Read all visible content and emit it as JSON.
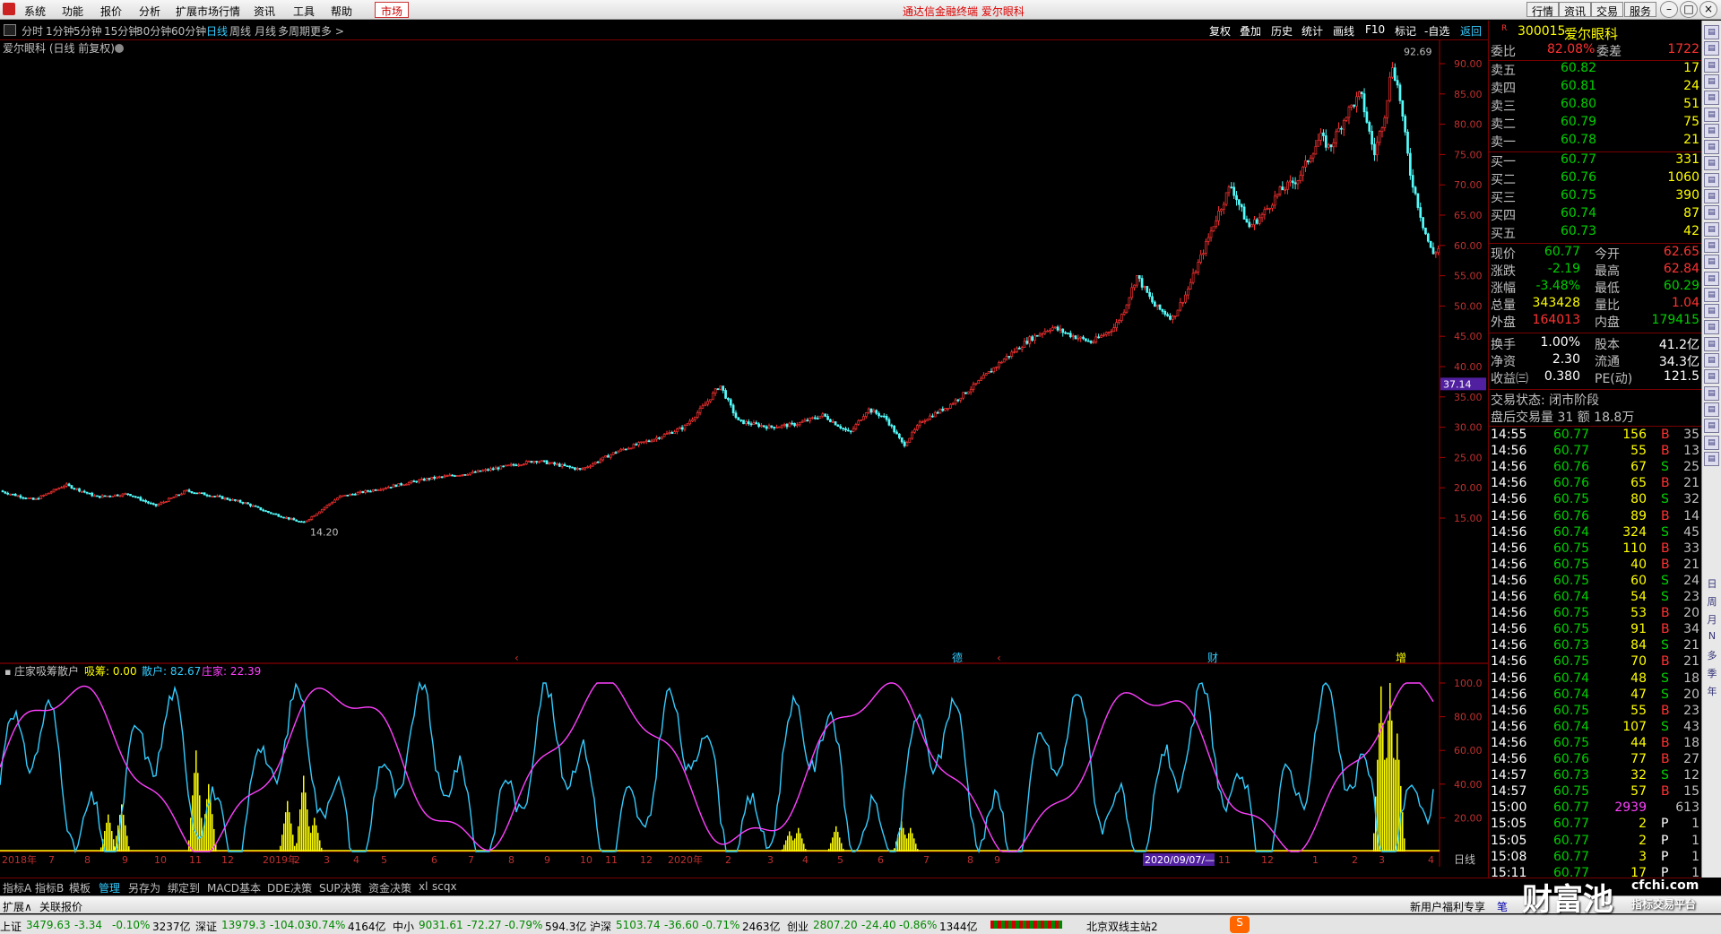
{
  "menu": {
    "items": [
      "系统",
      "功能",
      "报价",
      "分析",
      "扩展市场行情",
      "资讯",
      "工具",
      "帮助"
    ],
    "market": "市场",
    "title": "通达信金融终端  爱尔眼科",
    "right_buttons": [
      "行情",
      "资讯",
      "交易",
      "服务"
    ]
  },
  "periods": {
    "items": [
      "分时",
      "1分钟",
      "5分钟",
      "15分钟",
      "30分钟",
      "60分钟",
      "日线",
      "周线",
      "月线",
      "多周期",
      "更多 >"
    ],
    "active": "日线",
    "tools": [
      "复权",
      "叠加",
      "历史",
      "统计",
      "画线",
      "F10",
      "标记",
      "-自选"
    ],
    "back": "返回"
  },
  "chart": {
    "title": "爱尔眼科 (日线 前复权)",
    "high_label": "92.69",
    "low_label": "14.20",
    "current_price_tag": "37.14",
    "y_ticks": [
      "90.00",
      "85.00",
      "80.00",
      "75.00",
      "70.00",
      "65.00",
      "60.00",
      "55.00",
      "50.00",
      "45.00",
      "40.00",
      "35.00",
      "30.00",
      "25.00",
      "20.00",
      "15.00"
    ],
    "event_markers": [
      "‹",
      "德",
      "‹",
      "财",
      "增"
    ],
    "ind_name": "庄家吸筹散户",
    "ind_xichou": "吸筹: 0.00",
    "ind_sanhu": "散户: 82.67",
    "ind_zhuangjia": "庄家: 22.39",
    "ind_ticks": [
      "100.0",
      "80.00",
      "60.00",
      "40.00",
      "20.00"
    ],
    "x_labels": [
      "2018年",
      "7",
      "8",
      "9",
      "10",
      "11",
      "12",
      "2019年",
      "2",
      "3",
      "4",
      "5",
      "6",
      "7",
      "8",
      "9",
      "10",
      "11",
      "12",
      "2020年",
      "2",
      "3",
      "4",
      "5",
      "6",
      "7",
      "8",
      "9",
      "2020/09/07/—",
      "11",
      "12",
      "1",
      "2",
      "3",
      "4"
    ],
    "period_label": "日线",
    "colors": {
      "up": "#ff3232",
      "down": "#54fcfc",
      "sanhu": "#ff40ff",
      "zhuangjia": "#3cf",
      "xichou": "#ffff00"
    }
  },
  "chart_data": {
    "type": "candlestick",
    "x_range": [
      "2018-06",
      "2021-04"
    ],
    "y_range": [
      14.2,
      92.69
    ],
    "key_points": [
      {
        "x": "2018",
        "y": 19.5
      },
      {
        "x": "2018-10",
        "y": 17.5
      },
      {
        "x": "2019-01",
        "y": 14.2
      },
      {
        "x": "2019-06",
        "y": 24.5
      },
      {
        "x": "2019-10",
        "y": 36.0
      },
      {
        "x": "2020-03",
        "y": 27.0
      },
      {
        "x": "2020-06",
        "y": 47.5
      },
      {
        "x": "2020-09",
        "y": 70.5
      },
      {
        "x": "2021-01",
        "y": 92.69
      },
      {
        "x": "2021-03",
        "y": 54.5
      },
      {
        "x": "2021-04",
        "y": 60.77
      }
    ]
  },
  "quote": {
    "code": "300015",
    "name": "爱尔眼科",
    "weibi_label": "委比",
    "weibi": "82.08%",
    "weicha_label": "委差",
    "weicha": "1722",
    "asks": [
      {
        "label": "卖五",
        "price": "60.82",
        "vol": "17"
      },
      {
        "label": "卖四",
        "price": "60.81",
        "vol": "24"
      },
      {
        "label": "卖三",
        "price": "60.80",
        "vol": "51"
      },
      {
        "label": "卖二",
        "price": "60.79",
        "vol": "75"
      },
      {
        "label": "卖一",
        "price": "60.78",
        "vol": "21"
      }
    ],
    "bids": [
      {
        "label": "买一",
        "price": "60.77",
        "vol": "331"
      },
      {
        "label": "买二",
        "price": "60.76",
        "vol": "1060"
      },
      {
        "label": "买三",
        "price": "60.75",
        "vol": "390"
      },
      {
        "label": "买四",
        "price": "60.74",
        "vol": "87"
      },
      {
        "label": "买五",
        "price": "60.73",
        "vol": "42"
      }
    ],
    "stats": [
      {
        "l1": "现价",
        "v1": "60.77",
        "c1": "g",
        "l2": "今开",
        "v2": "62.65",
        "c2": "r"
      },
      {
        "l1": "涨跌",
        "v1": "-2.19",
        "c1": "g",
        "l2": "最高",
        "v2": "62.84",
        "c2": "r"
      },
      {
        "l1": "涨幅",
        "v1": "-3.48%",
        "c1": "g",
        "l2": "最低",
        "v2": "60.29",
        "c2": "g"
      },
      {
        "l1": "总量",
        "v1": "343428",
        "c1": "y",
        "l2": "量比",
        "v2": "1.04",
        "c2": "r"
      },
      {
        "l1": "外盘",
        "v1": "164013",
        "c1": "r",
        "l2": "内盘",
        "v2": "179415",
        "c2": "g"
      },
      {
        "l1": "换手",
        "v1": "1.00%",
        "c1": "w",
        "l2": "股本",
        "v2": "41.2亿",
        "c2": "w"
      },
      {
        "l1": "净资",
        "v1": "2.30",
        "c1": "w",
        "l2": "流通",
        "v2": "34.3亿",
        "c2": "w"
      },
      {
        "l1": "收益㈢",
        "v1": "0.380",
        "c1": "w",
        "l2": "PE(动)",
        "v2": "121.5",
        "c2": "w"
      }
    ],
    "state": "交易状态: 闭市阶段",
    "after": "盘后交易量 31 额 18.8万",
    "ticks": [
      {
        "t": "14:55",
        "p": "60.77",
        "v": "156",
        "d": "B",
        "n": "35"
      },
      {
        "t": "14:56",
        "p": "60.77",
        "v": "55",
        "d": "B",
        "n": "13"
      },
      {
        "t": "14:56",
        "p": "60.76",
        "v": "67",
        "d": "S",
        "n": "25"
      },
      {
        "t": "14:56",
        "p": "60.76",
        "v": "65",
        "d": "B",
        "n": "21"
      },
      {
        "t": "14:56",
        "p": "60.75",
        "v": "80",
        "d": "S",
        "n": "32"
      },
      {
        "t": "14:56",
        "p": "60.76",
        "v": "89",
        "d": "B",
        "n": "14"
      },
      {
        "t": "14:56",
        "p": "60.74",
        "v": "324",
        "d": "S",
        "n": "45"
      },
      {
        "t": "14:56",
        "p": "60.75",
        "v": "110",
        "d": "B",
        "n": "33"
      },
      {
        "t": "14:56",
        "p": "60.75",
        "v": "40",
        "d": "B",
        "n": "21"
      },
      {
        "t": "14:56",
        "p": "60.75",
        "v": "60",
        "d": "S",
        "n": "24"
      },
      {
        "t": "14:56",
        "p": "60.74",
        "v": "54",
        "d": "S",
        "n": "23"
      },
      {
        "t": "14:56",
        "p": "60.75",
        "v": "53",
        "d": "B",
        "n": "20"
      },
      {
        "t": "14:56",
        "p": "60.75",
        "v": "91",
        "d": "B",
        "n": "34"
      },
      {
        "t": "14:56",
        "p": "60.73",
        "v": "84",
        "d": "S",
        "n": "21"
      },
      {
        "t": "14:56",
        "p": "60.75",
        "v": "70",
        "d": "B",
        "n": "21"
      },
      {
        "t": "14:56",
        "p": "60.74",
        "v": "48",
        "d": "S",
        "n": "18"
      },
      {
        "t": "14:56",
        "p": "60.74",
        "v": "47",
        "d": "S",
        "n": "20"
      },
      {
        "t": "14:56",
        "p": "60.75",
        "v": "55",
        "d": "B",
        "n": "23"
      },
      {
        "t": "14:56",
        "p": "60.74",
        "v": "107",
        "d": "S",
        "n": "43"
      },
      {
        "t": "14:56",
        "p": "60.75",
        "v": "44",
        "d": "B",
        "n": "18"
      },
      {
        "t": "14:56",
        "p": "60.76",
        "v": "77",
        "d": "B",
        "n": "27"
      },
      {
        "t": "14:57",
        "p": "60.73",
        "v": "32",
        "d": "S",
        "n": "12"
      },
      {
        "t": "14:57",
        "p": "60.75",
        "v": "57",
        "d": "B",
        "n": "15"
      },
      {
        "t": "15:00",
        "p": "60.77",
        "v": "2939",
        "d": "",
        "n": "613"
      },
      {
        "t": "15:05",
        "p": "60.77",
        "v": "2",
        "d": "P",
        "n": "1"
      },
      {
        "t": "15:05",
        "p": "60.77",
        "v": "2",
        "d": "P",
        "n": "1"
      },
      {
        "t": "15:08",
        "p": "60.77",
        "v": "3",
        "d": "P",
        "n": "1"
      },
      {
        "t": "15:11",
        "p": "60.77",
        "v": "17",
        "d": "P",
        "n": "1"
      },
      {
        "t": "15:13",
        "p": "60.77",
        "v": "7",
        "d": "P",
        "n": "1"
      }
    ]
  },
  "toolbar_side": [
    "日",
    "周",
    "月",
    "N",
    "多",
    "季",
    "年"
  ],
  "tabs": [
    "指标A",
    "指标B",
    "模板",
    "管理",
    "另存为",
    "绑定到",
    "MACD基本",
    "DDE决策",
    "SUP决策",
    "资金决策",
    "xl",
    "scqx"
  ],
  "tabs_active": "管理",
  "sub": {
    "expand": "扩展∧",
    "quote": "关联报价",
    "promo": "新用户福利专享",
    "pen": "笔"
  },
  "status": {
    "items": [
      {
        "name": "上证",
        "p": "3479.63",
        "ch": "-3.34",
        "pc": "-0.10%",
        "amt": "3237亿"
      },
      {
        "name": "深证",
        "p": "13979.3",
        "ch": "-104.03",
        "pc": "-0.74%",
        "amt": "4164亿"
      },
      {
        "name": "中小",
        "p": "9031.61",
        "ch": "-72.27",
        "pc": "-0.79%",
        "amt": "594.3亿"
      },
      {
        "name": "沪深",
        "p": "5103.74",
        "ch": "-36.60",
        "pc": "-0.71%",
        "amt": "2463亿"
      },
      {
        "name": "创业",
        "p": "2807.20",
        "ch": "-24.40",
        "pc": "-0.86%",
        "amt": "1344亿"
      }
    ],
    "server": "北京双线主站2"
  },
  "logo": {
    "main": "财富池",
    "url": "cfchi.com",
    "sub": "指标交易平台"
  }
}
